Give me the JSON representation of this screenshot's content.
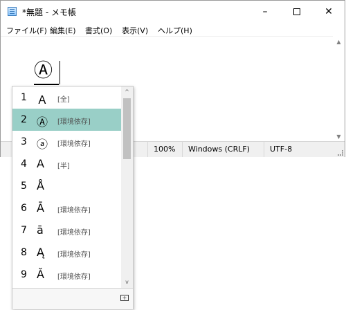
{
  "window": {
    "title": "*無題 - メモ帳",
    "controls": {
      "minimize": "–",
      "close": "✕"
    }
  },
  "menu": [
    "ファイル(F)",
    "編集(E)",
    "書式(O)",
    "表示(V)",
    "ヘルプ(H)"
  ],
  "editor": {
    "text": "Ⓐ"
  },
  "statusbar": {
    "zoom": "100%",
    "line_ending": "Windows (CRLF)",
    "encoding": "UTF-8"
  },
  "candidates": {
    "selected_index": 1,
    "items": [
      {
        "num": "1",
        "char": "Ａ",
        "note": "[全]"
      },
      {
        "num": "2",
        "char": "Ⓐ",
        "note": "[環境依存]"
      },
      {
        "num": "3",
        "char": "ⓐ",
        "note": "[環境依存]"
      },
      {
        "num": "4",
        "char": "A",
        "note": "[半]"
      },
      {
        "num": "5",
        "char": "Å",
        "note": ""
      },
      {
        "num": "6",
        "char": "Ā",
        "note": "[環境依存]"
      },
      {
        "num": "7",
        "char": "ā",
        "note": "[環境依存]"
      },
      {
        "num": "8",
        "char": "Ą",
        "note": "[環境依存]"
      },
      {
        "num": "9",
        "char": "Ǎ",
        "note": "[環境依存]"
      }
    ]
  },
  "icons": {
    "app": "notepad-icon",
    "expand": "expand-table-icon"
  }
}
